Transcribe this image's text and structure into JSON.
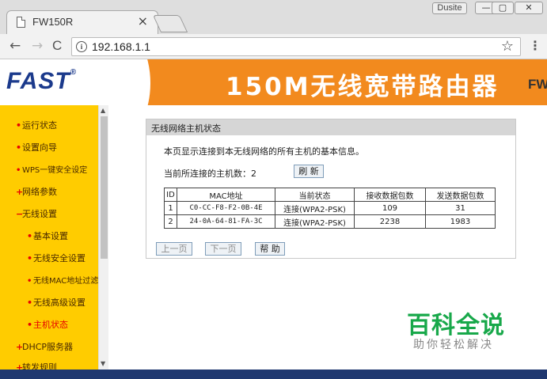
{
  "browser": {
    "tab_title": "FW150R",
    "tab_close": "×",
    "user_badge": "Dusite",
    "window_min": "—",
    "window_max": "▢",
    "window_close": "✕",
    "back": "←",
    "forward": "→",
    "reload": "C",
    "info": "i",
    "url": "192.168.1.1",
    "star": "☆",
    "menu": "⋮"
  },
  "banner": {
    "logo": "FAST",
    "logo_mark": "®",
    "title": "150M无线宽带路由器",
    "model_partial": "FW"
  },
  "sidebar": {
    "items": [
      {
        "label": "运行状态",
        "bullet": "•"
      },
      {
        "label": "设置向导",
        "bullet": "•"
      },
      {
        "label": "WPS一键安全设定",
        "bullet": "•"
      },
      {
        "label": "网络参数",
        "bullet": "+"
      },
      {
        "label": "无线设置",
        "bullet": "−"
      },
      {
        "label": "基本设置",
        "bullet": "•"
      },
      {
        "label": "无线安全设置",
        "bullet": "•"
      },
      {
        "label": "无线MAC地址过滤",
        "bullet": "•"
      },
      {
        "label": "无线高级设置",
        "bullet": "•"
      },
      {
        "label": "主机状态",
        "bullet": "•"
      },
      {
        "label": "DHCP服务器",
        "bullet": "+"
      },
      {
        "label": "转发规则",
        "bullet": "+"
      }
    ]
  },
  "panel": {
    "title": "无线网络主机状态",
    "description": "本页显示连接到本无线网络的所有主机的基本信息。",
    "host_count_label": "当前所连接的主机数：",
    "host_count": "2",
    "refresh_label": "刷 新",
    "table": {
      "headers": [
        "ID",
        "MAC地址",
        "当前状态",
        "接收数据包数",
        "发送数据包数"
      ],
      "rows": [
        [
          "1",
          "C0-CC-F8-F2-0B-4E",
          "连接(WPA2-PSK)",
          "109",
          "31"
        ],
        [
          "2",
          "24-0A-64-81-FA-3C",
          "连接(WPA2-PSK)",
          "2238",
          "1983"
        ]
      ]
    },
    "prev_label": "上一页",
    "next_label": "下一页",
    "help_label": "帮 助"
  },
  "watermark": {
    "title": "百科全说",
    "subtitle": "助你轻松解决"
  },
  "colors": {
    "banner_orange": "#f28a1e",
    "sidebar_yellow": "#ffcc00",
    "logo_blue": "#1b3a8c",
    "bottom_navy": "#1f3870",
    "active_red": "#e60000",
    "watermark_green": "#18a84a"
  }
}
